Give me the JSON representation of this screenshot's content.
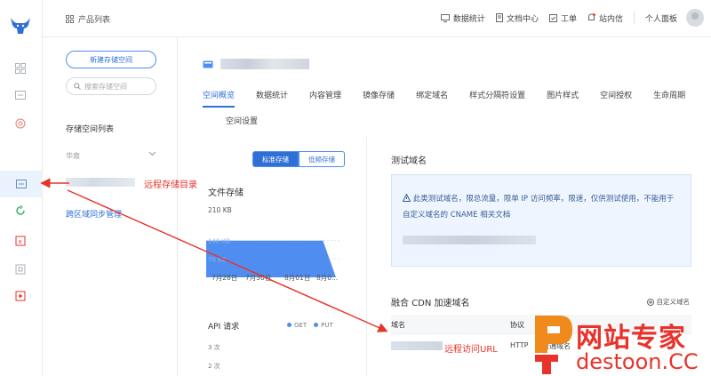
{
  "header": {
    "product_list": "产品列表",
    "nav": [
      {
        "label": "数据统计",
        "icon": "chart-icon"
      },
      {
        "label": "文档中心",
        "icon": "document-icon"
      },
      {
        "label": "工单",
        "icon": "ticket-icon"
      },
      {
        "label": "站内信",
        "icon": "bell-icon"
      }
    ],
    "panel": "个人面板"
  },
  "bucket_list": {
    "new_button": "新建存储空间",
    "search_placeholder": "搜索存储空间",
    "title": "存储空间列表",
    "region": "华南",
    "sync": "跨区域同步管理"
  },
  "main": {
    "tabs": [
      "空间概览",
      "数据统计",
      "内容管理",
      "镜像存储",
      "绑定域名",
      "样式分隔符设置",
      "图片样式",
      "空间授权",
      "生命周期",
      "空间设置"
    ],
    "active_tab": 0,
    "storage_toggle": {
      "standard": "标准存储",
      "low": "低频存储"
    },
    "file_storage": "文件存储",
    "api_requests": "API 请求",
    "api_legend": [
      "GET",
      "PUT"
    ],
    "api_ticks": [
      "3 次",
      "2 次"
    ],
    "test_domain": {
      "title": "测试域名",
      "notice": "此类测试域名，限总流量，限单 IP 访问频率，限速，仅供测试使用，不能用于自定义域名的 CNAME 相关文档"
    },
    "cdn": {
      "title": "融合 CDN 加速域名",
      "custom": "自定义域名",
      "columns": [
        "域名",
        "协议",
        "类型"
      ],
      "row": {
        "protocol": "HTTP",
        "type": "普通域名"
      }
    }
  },
  "annotations": {
    "remote_dir": "远程存储目录",
    "remote_url": "远程访问URL"
  },
  "watermark": {
    "line1": "网站专家",
    "line2": "destoon.CC"
  },
  "colors": {
    "accent": "#2f6fd6",
    "annotation": "#e8322a",
    "chart_fill": "#4f8ef0"
  },
  "chart_data": {
    "type": "area",
    "title": "文件存储",
    "x": [
      "7月28日",
      "7月30日",
      "8月01日",
      "8月0..."
    ],
    "series": [
      {
        "values": [
          140,
          140,
          140,
          140,
          140,
          140,
          140,
          140,
          140,
          140,
          0
        ]
      }
    ],
    "y_ticks": [
      "210 KB",
      "140 KB",
      "70 KB"
    ],
    "ylim": [
      0,
      210
    ]
  }
}
